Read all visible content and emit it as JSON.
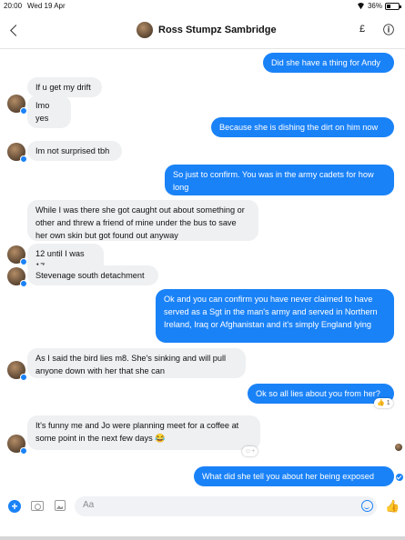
{
  "status_bar": {
    "time": "20:00",
    "date": "Wed 19 Apr",
    "battery": "36%",
    "battery_level": 0.36
  },
  "header": {
    "title": "Ross Stumpz Sambridge",
    "pound_label": "£",
    "info_icon": "info-icon",
    "back_icon": "chevron-left-icon"
  },
  "messages": [
    {
      "side": "out",
      "text": "Did she have a thing for Andy"
    },
    {
      "side": "in",
      "text": "If u get my drift"
    },
    {
      "side": "in",
      "text": "Imo yes"
    },
    {
      "side": "out",
      "text": "Because she is dishing the dirt on him now"
    },
    {
      "side": "in",
      "text": "Im not surprised tbh"
    },
    {
      "side": "out",
      "text": "So just to confirm. You was in the army cadets for how long"
    },
    {
      "side": "in",
      "text": "While I was there she got caught out about something or other and threw a friend of mine under the bus to save her own skin but got found out anyway"
    },
    {
      "side": "in",
      "text": "12 until I was 17"
    },
    {
      "side": "in",
      "text": "Stevenage south detachment"
    },
    {
      "side": "out",
      "text": "Ok and you can confirm you have never claimed to have served as a Sgt in the man's army and served in Northern Ireland, Iraq or Afghanistan and it's simply England lying"
    },
    {
      "side": "in",
      "text": "As I said the bird lies m8. She's sinking and will pull anyone down with her that she can"
    },
    {
      "side": "out",
      "text": "Ok so all lies about you from her?",
      "reaction": "1"
    },
    {
      "side": "in",
      "text": "It's funny me and Jo were planning meet for a coffee at some point in the next few days 😂"
    },
    {
      "side": "out",
      "text": "What did she tell you about her being exposed"
    }
  ],
  "composer": {
    "placeholder": "Aa"
  },
  "colors": {
    "accent": "#1a82f7",
    "incoming_bubble": "#eef0f2"
  }
}
